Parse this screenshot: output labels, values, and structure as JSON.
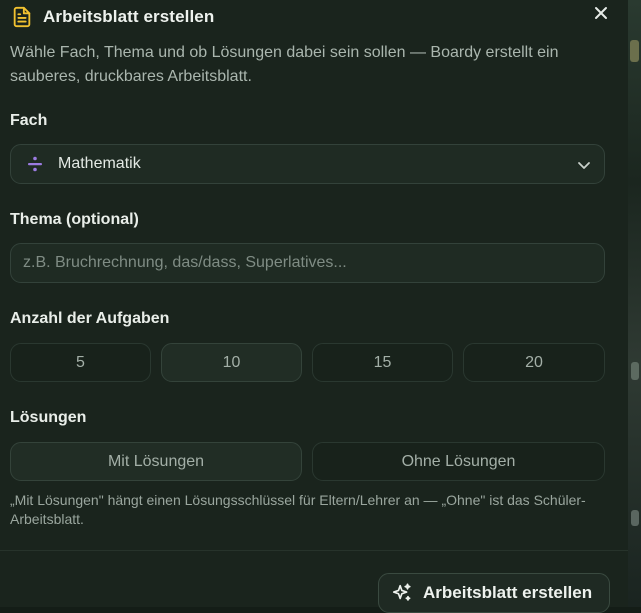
{
  "dialog": {
    "title": "Arbeitsblatt erstellen",
    "title_icon": "document-icon",
    "close_icon": "close-icon",
    "description": "Wähle Fach, Thema und ob Lösungen dabei sein sollen — Boardy erstellt ein sauberes, druckbares Arbeitsblatt."
  },
  "subject": {
    "label": "Fach",
    "icon": "division-icon",
    "selected": "Mathematik"
  },
  "topic": {
    "label": "Thema (optional)",
    "value": "",
    "placeholder": "z.B. Bruchrechnung, das/dass, Superlatives..."
  },
  "task_count": {
    "label": "Anzahl der Aufgaben",
    "options": [
      "5",
      "10",
      "15",
      "20"
    ],
    "selected": "10"
  },
  "solutions": {
    "label": "Lösungen",
    "options": [
      "Mit Lösungen",
      "Ohne Lösungen"
    ],
    "selected": "Mit Lösungen",
    "hint": "„Mit Lösungen\" hängt einen Lösungsschlüssel für Eltern/Lehrer an — „Ohne\" ist das Schüler-Arbeitsblatt."
  },
  "actions": {
    "create_label": "Arbeitsblatt erstellen",
    "create_icon": "sparkle-icon"
  },
  "colors": {
    "accent_yellow": "#f2c230",
    "accent_purple": "#9b7be0",
    "panel_bg": "#1a241d"
  }
}
